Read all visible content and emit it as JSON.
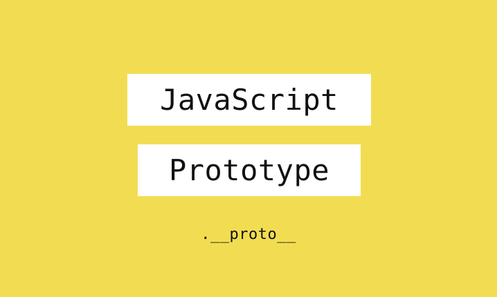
{
  "banner": {
    "title_line_1": "JavaScript",
    "title_line_2": "Prototype",
    "subtitle": ".__proto__",
    "background_color": "#f2dd52",
    "box_color": "#ffffff",
    "text_color": "#111111"
  }
}
